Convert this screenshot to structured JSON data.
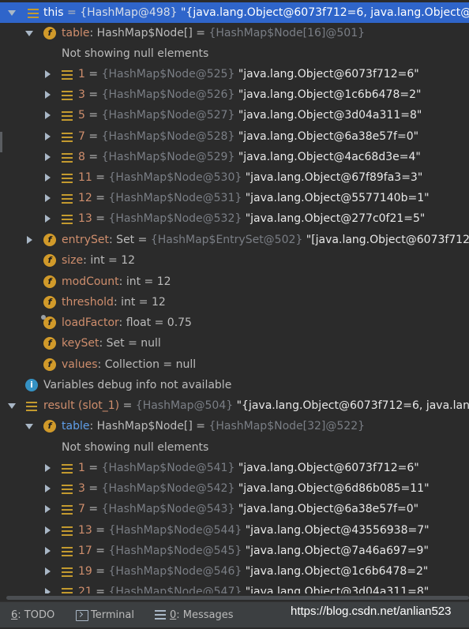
{
  "tree": {
    "this_node": {
      "name": "this",
      "eq": " = ",
      "ref": "{HashMap@498}",
      "value": " \"{java.lang.Object@6073f712=6, java.lang.Object@"
    },
    "table1": {
      "name": "table",
      "type": ": HashMap$Node[]",
      "eq": "  = ",
      "ref": "{HashMap$Node[16]@501}"
    },
    "null_note_1": "Not showing null elements",
    "table1_items": [
      {
        "index": "1",
        "eq": " = ",
        "ref": "{HashMap$Node@525}",
        "value": " \"java.lang.Object@6073f712=6\""
      },
      {
        "index": "3",
        "eq": " = ",
        "ref": "{HashMap$Node@526}",
        "value": " \"java.lang.Object@1c6b6478=2\""
      },
      {
        "index": "5",
        "eq": " = ",
        "ref": "{HashMap$Node@527}",
        "value": " \"java.lang.Object@3d04a311=8\""
      },
      {
        "index": "7",
        "eq": " = ",
        "ref": "{HashMap$Node@528}",
        "value": " \"java.lang.Object@6a38e57f=0\""
      },
      {
        "index": "8",
        "eq": " = ",
        "ref": "{HashMap$Node@529}",
        "value": " \"java.lang.Object@4ac68d3e=4\""
      },
      {
        "index": "11",
        "eq": " = ",
        "ref": "{HashMap$Node@530}",
        "value": " \"java.lang.Object@67f89fa3=3\""
      },
      {
        "index": "12",
        "eq": " = ",
        "ref": "{HashMap$Node@531}",
        "value": " \"java.lang.Object@5577140b=1\""
      },
      {
        "index": "13",
        "eq": " = ",
        "ref": "{HashMap$Node@532}",
        "value": " \"java.lang.Object@277c0f21=5\""
      }
    ],
    "entryset": {
      "name": "entrySet",
      "type": ": Set",
      "eq": "  = ",
      "ref": "{HashMap$EntrySet@502}",
      "value": " \"[java.lang.Object@6073f712"
    },
    "size": {
      "name": "size",
      "rest": ": int  = 12"
    },
    "modcount": {
      "name": "modCount",
      "rest": ": int  = 12"
    },
    "threshold": {
      "name": "threshold",
      "rest": ": int  = 12"
    },
    "loadfactor": {
      "name": "loadFactor",
      "rest": ": float  = 0.75"
    },
    "keyset": {
      "name": "keySet",
      "rest": ": Set  = null"
    },
    "values": {
      "name": "values",
      "rest": ": Collection  = null"
    },
    "info": "Variables debug info not available",
    "result_node": {
      "name": "result (slot_1)",
      "eq": " = ",
      "ref": "{HashMap@504}",
      "value": " \"{java.lang.Object@6073f712=6, java.lang"
    },
    "table2": {
      "name": "table",
      "type": ": HashMap$Node[]",
      "eq": "  = ",
      "ref": "{HashMap$Node[32]@522}"
    },
    "null_note_2": "Not showing null elements",
    "table2_items": [
      {
        "index": "1",
        "eq": " = ",
        "ref": "{HashMap$Node@541}",
        "value": " \"java.lang.Object@6073f712=6\""
      },
      {
        "index": "3",
        "eq": " = ",
        "ref": "{HashMap$Node@542}",
        "value": " \"java.lang.Object@6d86b085=11\""
      },
      {
        "index": "7",
        "eq": " = ",
        "ref": "{HashMap$Node@543}",
        "value": " \"java.lang.Object@6a38e57f=0\""
      },
      {
        "index": "13",
        "eq": " = ",
        "ref": "{HashMap$Node@544}",
        "value": " \"java.lang.Object@43556938=7\""
      },
      {
        "index": "17",
        "eq": " = ",
        "ref": "{HashMap$Node@545}",
        "value": " \"java.lang.Object@7a46a697=9\""
      },
      {
        "index": "19",
        "eq": " = ",
        "ref": "{HashMap$Node@546}",
        "value": " \"java.lang.Object@1c6b6478=2\""
      },
      {
        "index": "21",
        "eq": " = ",
        "ref": "{HashMap$Node@547}",
        "value": " \"java.lang.Object@3d04a311=8\""
      }
    ]
  },
  "statusbar": {
    "todo_key": "6",
    "todo_label": ": TODO",
    "terminal_label": "Terminal",
    "messages_key": "0",
    "messages_label": ": Messages"
  },
  "watermark": "https://blog.csdn.net/anlian523",
  "colors": {
    "background": "#2b2b2b",
    "selection": "#2f65ca",
    "field_name": "#cf8e6d",
    "reference": "#7a7e85"
  }
}
